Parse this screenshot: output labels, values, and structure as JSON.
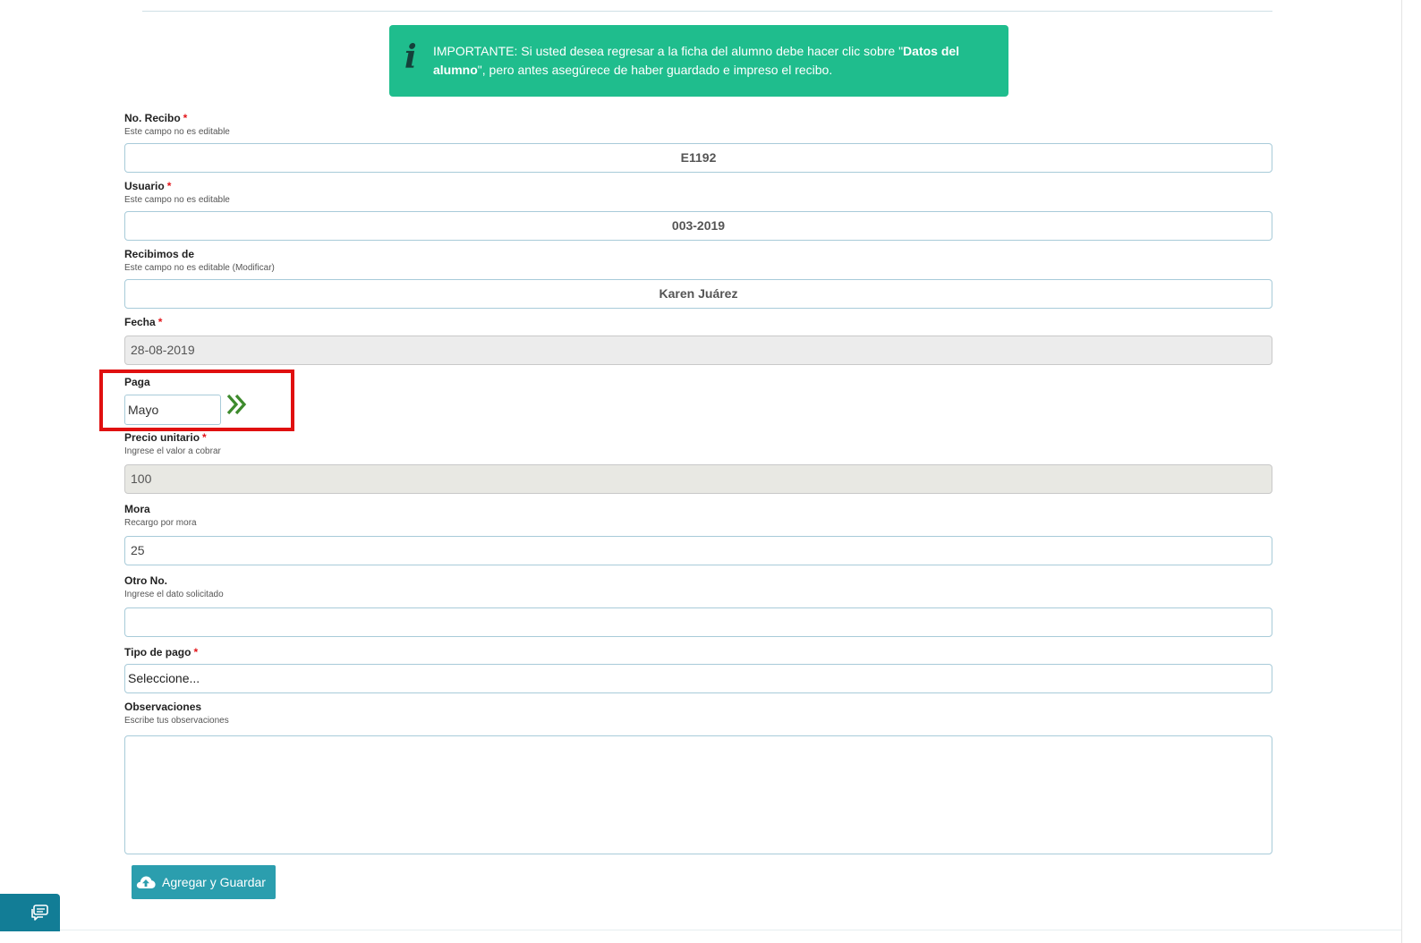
{
  "alert": {
    "text_before": "IMPORTANTE: Si usted desea regresar a la ficha del alumno debe hacer clic sobre \"",
    "link_text": "Datos del alumno",
    "text_after": "\", pero antes asegúrece de haber guardado e impreso el recibo."
  },
  "form": {
    "no_recibo": {
      "label": "No. Recibo",
      "required": "*",
      "help": "Este campo no es editable",
      "value": "E1192"
    },
    "usuario": {
      "label": "Usuario",
      "required": "*",
      "help": "Este campo no es editable",
      "value": "003-2019"
    },
    "recibimos_de": {
      "label": "Recibimos de",
      "help": "Este campo no es editable",
      "help_link": "(Modificar)",
      "value": "Karen Juárez"
    },
    "fecha": {
      "label": "Fecha",
      "required": "*",
      "value": "28-08-2019"
    },
    "paga": {
      "label": "Paga",
      "value": "Mayo"
    },
    "precio_unitario": {
      "label": "Precio unitario",
      "required": "*",
      "help": "Ingrese el valor a cobrar",
      "value": "100"
    },
    "mora": {
      "label": "Mora",
      "help": "Recargo por mora",
      "value": "25"
    },
    "otro_no": {
      "label": "Otro No.",
      "help": "Ingrese el dato solicitado",
      "value": ""
    },
    "tipo_pago": {
      "label": "Tipo de pago",
      "required": "*",
      "selected": "Seleccione..."
    },
    "observaciones": {
      "label": "Observaciones",
      "help": "Escribe tus observaciones",
      "value": ""
    }
  },
  "buttons": {
    "save_label": "Agregar y Guardar"
  },
  "icons": {
    "alert": "info-icon",
    "paga_next": "double-chevron-right-icon",
    "save": "cloud-upload-icon",
    "chat": "chat-icon"
  },
  "colors": {
    "alert_bg": "#1fbd8d",
    "button_bg": "#2b9eae",
    "highlight": "#e01010",
    "required": "#e3161b",
    "chat_bg": "#127d96"
  }
}
